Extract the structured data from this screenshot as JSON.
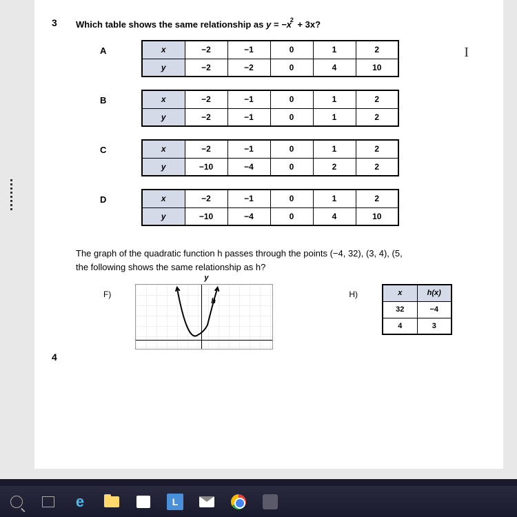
{
  "q3": {
    "number": "3",
    "text_prefix": "Which table shows the same relationship as ",
    "equation": "y = −x",
    "exponent": "2",
    "equation_suffix": " + 3x?",
    "options": [
      {
        "label": "A",
        "rows": [
          {
            "header": "x",
            "cells": [
              "−2",
              "−1",
              "0",
              "1",
              "2"
            ]
          },
          {
            "header": "y",
            "cells": [
              "−2",
              "−2",
              "0",
              "4",
              "10"
            ]
          }
        ]
      },
      {
        "label": "B",
        "rows": [
          {
            "header": "x",
            "cells": [
              "−2",
              "−1",
              "0",
              "1",
              "2"
            ]
          },
          {
            "header": "y",
            "cells": [
              "−2",
              "−1",
              "0",
              "1",
              "2"
            ]
          }
        ]
      },
      {
        "label": "C",
        "rows": [
          {
            "header": "x",
            "cells": [
              "−2",
              "−1",
              "0",
              "1",
              "2"
            ]
          },
          {
            "header": "y",
            "cells": [
              "−10",
              "−4",
              "0",
              "2",
              "2"
            ]
          }
        ]
      },
      {
        "label": "D",
        "rows": [
          {
            "header": "x",
            "cells": [
              "−2",
              "−1",
              "0",
              "1",
              "2"
            ]
          },
          {
            "header": "y",
            "cells": [
              "−10",
              "−4",
              "0",
              "4",
              "10"
            ]
          }
        ]
      }
    ]
  },
  "q4": {
    "number": "4",
    "text": "The graph of the quadratic function h passes through the points (−4, 32), (3, 4), (5,",
    "text2": "the following shows the same relationship as h?",
    "opt_f_label": "F)",
    "y_label": "y",
    "h_label": "h",
    "opt_h_label": "H)",
    "h_table": {
      "headers": [
        "x",
        "h(x)"
      ],
      "rows": [
        [
          "32",
          "−4"
        ],
        [
          "4",
          "3"
        ]
      ]
    }
  },
  "cursor": "I"
}
